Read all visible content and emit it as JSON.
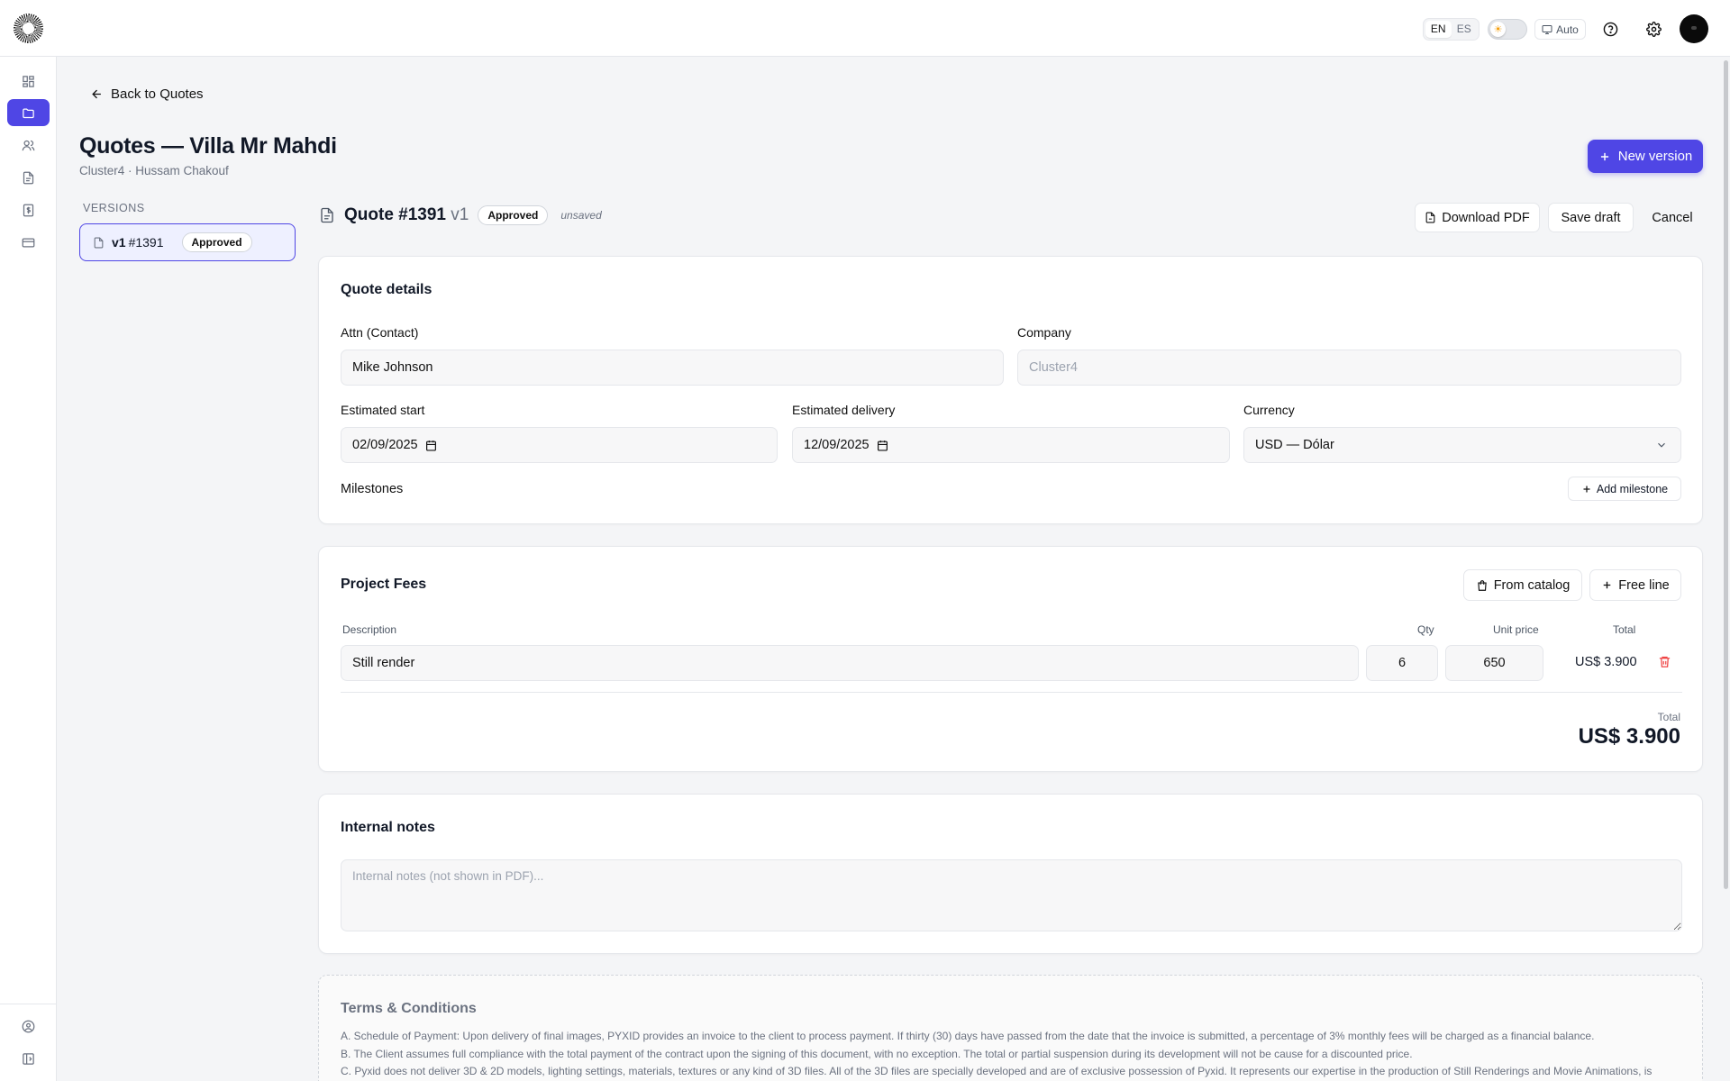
{
  "topbar": {
    "lang": [
      "EN",
      "ES"
    ],
    "active_lang": "EN",
    "theme_mode": "Auto"
  },
  "sidebar": {
    "items": [
      {
        "icon": "dashboard-icon"
      },
      {
        "icon": "folder-icon",
        "active": true
      },
      {
        "icon": "users-icon"
      },
      {
        "icon": "document-icon"
      },
      {
        "icon": "invoice-icon"
      },
      {
        "icon": "credit-card-icon"
      }
    ],
    "bottom": [
      {
        "icon": "account-icon"
      },
      {
        "icon": "sidebar-toggle-icon"
      }
    ]
  },
  "nav": {
    "back_label": "Back to Quotes"
  },
  "page": {
    "title": "Quotes — Villa Mr Mahdi",
    "subtitle": "Cluster4 · Hussam Chakouf",
    "new_version_label": "New version"
  },
  "versions": {
    "heading": "VERSIONS",
    "items": [
      {
        "label": "v1",
        "number": "#1391",
        "status": "Approved"
      }
    ]
  },
  "quote": {
    "title": "Quote #1391",
    "version": "v1",
    "status": "Approved",
    "dirty": "unsaved",
    "download_label": "Download PDF",
    "save_label": "Save draft",
    "cancel_label": "Cancel"
  },
  "details": {
    "title": "Quote details",
    "attn_label": "Attn (Contact)",
    "attn_value": "Mike Johnson",
    "company_label": "Company",
    "company_value": "Cluster4",
    "start_label": "Estimated start",
    "start_value": "02/09/2025",
    "delivery_label": "Estimated delivery",
    "delivery_value": "12/09/2025",
    "currency_label": "Currency",
    "currency_value": "USD — Dólar",
    "milestones_label": "Milestones",
    "add_milestone_label": "Add milestone"
  },
  "fees": {
    "title": "Project Fees",
    "from_catalog_label": "From catalog",
    "free_line_label": "Free line",
    "columns": {
      "description": "Description",
      "qty": "Qty",
      "unit_price": "Unit price",
      "total": "Total"
    },
    "lines": [
      {
        "description": "Still render",
        "qty": "6",
        "unit_price": "650",
        "total": "US$ 3.900"
      }
    ],
    "grand_total_label": "Total",
    "grand_total": "US$ 3.900"
  },
  "notes": {
    "title": "Internal notes",
    "placeholder": "Internal notes (not shown in PDF)..."
  },
  "terms": {
    "title": "Terms & Conditions",
    "lines": [
      "A. Schedule of Payment: Upon delivery of final images, PYXID provides an invoice to the client to process payment. If thirty (30) days have passed from the date that the invoice is submitted, a percentage of 3% monthly fees will be charged as a financial balance.",
      "B. The Client assumes full compliance with the total payment of the contract upon the signing of this document, with no exception. The total or partial suspension during its development will not be cause for a discounted price.",
      "C. Pyxid does not deliver 3D & 2D models, lighting settings, materials, textures or any kind of 3D files. All of the 3D files are specially developed and are of exclusive possession of Pyxid. It represents our expertise in the production of Still Renderings and Movie Animations, is"
    ]
  },
  "colors": {
    "accent": "#4f46e5",
    "danger": "#ef4444",
    "background": "#f4f5f7"
  }
}
